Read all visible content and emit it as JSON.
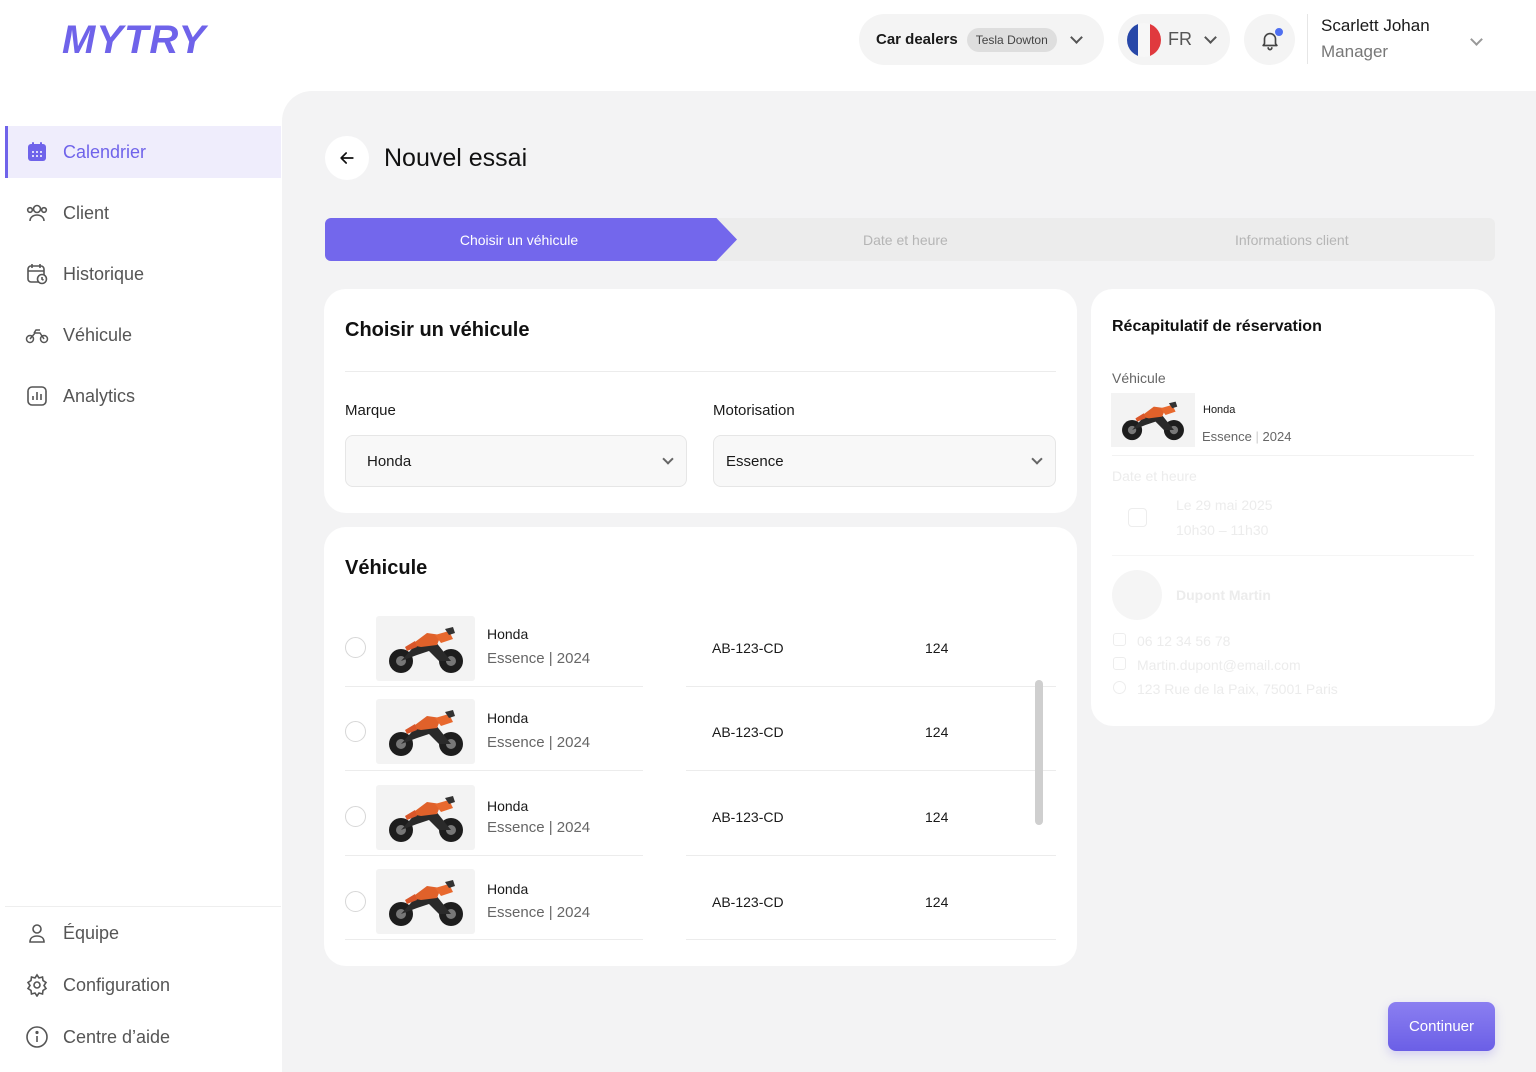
{
  "brand": {
    "logo": "MYTRY",
    "accent": "#6f63ea"
  },
  "header": {
    "dealer_label": "Car dealers",
    "dealer_badge": "Tesla Dowton",
    "language": "FR",
    "user_name": "Scarlett Johan",
    "user_role": "Manager",
    "notification_badge_color": "#4f6ff0"
  },
  "sidebar": {
    "items": [
      {
        "label": "Calendrier",
        "icon": "calendar-icon",
        "active": true
      },
      {
        "label": "Client",
        "icon": "users-icon",
        "active": false
      },
      {
        "label": "Historique",
        "icon": "calendar-clock-icon",
        "active": false
      },
      {
        "label": "Véhicule",
        "icon": "motorcycle-icon",
        "active": false
      },
      {
        "label": "Analytics",
        "icon": "analytics-icon",
        "active": false
      }
    ],
    "bottom_items": [
      {
        "label": "Équipe",
        "icon": "user-icon"
      },
      {
        "label": "Configuration",
        "icon": "gear-icon"
      },
      {
        "label": "Centre d’aide",
        "icon": "info-icon"
      }
    ]
  },
  "page": {
    "title": "Nouvel essai",
    "steps": [
      {
        "label": "Choisir un véhicule",
        "active": true
      },
      {
        "label": "Date et heure",
        "active": false
      },
      {
        "label": "Informations client",
        "active": false
      }
    ]
  },
  "filters": {
    "title": "Choisir un véhicule",
    "brand_label": "Marque",
    "brand_value": "Honda",
    "engine_label": "Motorisation",
    "engine_value": "Essence"
  },
  "vehicles": {
    "title": "Véhicule",
    "rows": [
      {
        "brand": "Honda",
        "fuel": "Essence",
        "year": "2024",
        "plate": "AB-123-CD",
        "number": "124"
      },
      {
        "brand": "Honda",
        "fuel": "Essence",
        "year": "2024",
        "plate": "AB-123-CD",
        "number": "124"
      },
      {
        "brand": "Honda",
        "fuel": "Essence",
        "year": "2024",
        "plate": "AB-123-CD",
        "number": "124"
      },
      {
        "brand": "Honda",
        "fuel": "Essence",
        "year": "2024",
        "plate": "AB-123-CD",
        "number": "124"
      }
    ]
  },
  "summary": {
    "title": "Récapitulatif de réservation",
    "vehicle_label": "Véhicule",
    "vehicle_brand": "Honda",
    "vehicle_fuel": "Essence",
    "vehicle_year": "2024",
    "date_label": "Date et heure",
    "date_value": "Le 29 mai 2025",
    "time_value": "10h30 – 11h30",
    "client_name": "Dupont Martin",
    "client_phone": "06 12 34 56 78",
    "client_email": "Martin.dupont@email.com",
    "client_address": "123 Rue de la Paix, 75001 Paris"
  },
  "actions": {
    "continue_label": "Continuer"
  }
}
